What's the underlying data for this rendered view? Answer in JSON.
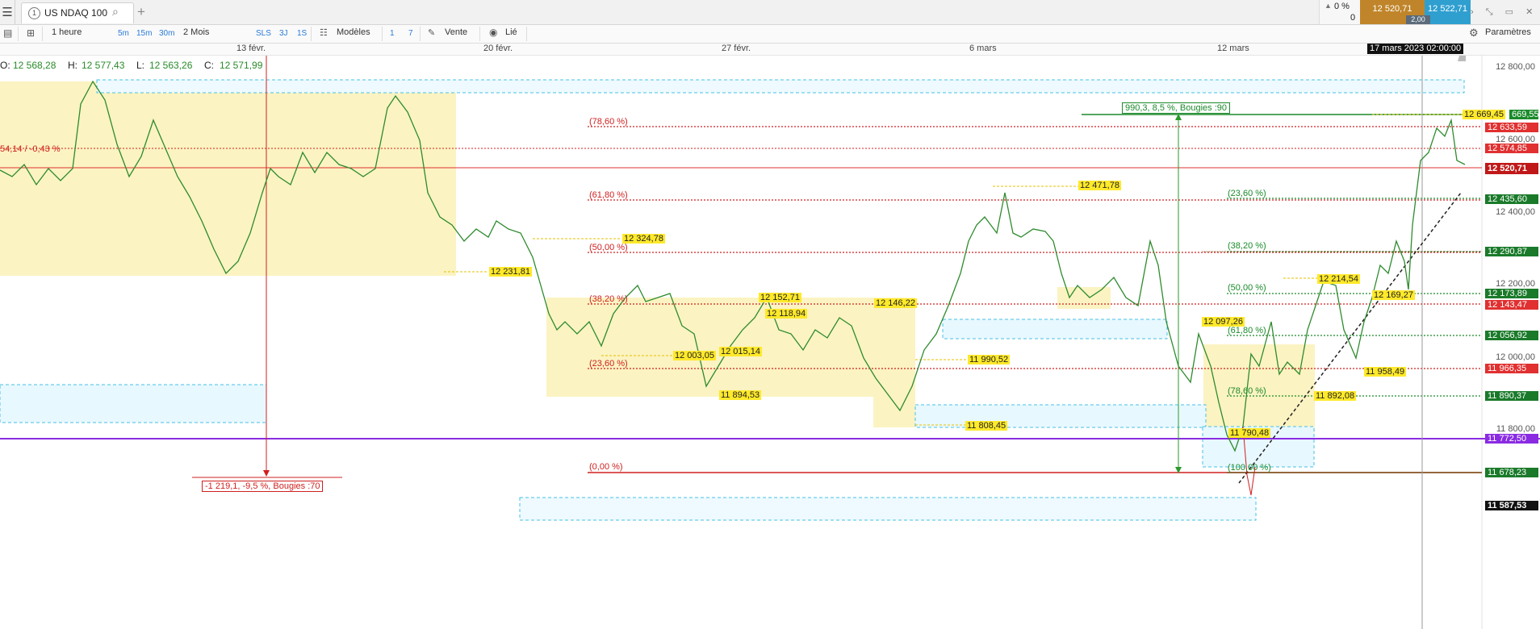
{
  "tab": {
    "number": "1",
    "title": "US NDAQ 100"
  },
  "toolbar": {
    "interval": "1 heure",
    "intervals": [
      "5m",
      "15m",
      "30m"
    ],
    "period": "2 Mois",
    "modes": [
      "SLS",
      "3J",
      "1S"
    ],
    "models": "Modèles",
    "days": [
      "1",
      "7"
    ],
    "sell": "Vente",
    "linked": "Lié",
    "settings": "Paramètres"
  },
  "position": {
    "pct": "0 %",
    "qty": "0",
    "bid": "12 520,71",
    "ask": "12 522,71",
    "spread": "2,00"
  },
  "dates": [
    "13 févr.",
    "20 févr.",
    "27 févr.",
    "6 mars",
    "12 mars"
  ],
  "cursor_date": "17 mars 2023 02:00:00",
  "ohlc": {
    "o_label": "O:",
    "o": "12 568,28",
    "h_label": "H:",
    "h": "12 577,43",
    "l_label": "L:",
    "l": "12 563,26",
    "c_label": "C:",
    "c": "12 571,99"
  },
  "y_axis": [
    "12 800,00",
    "12 600,00",
    "12 400,00",
    "12 200,00",
    "12 000,00",
    "11 800,00"
  ],
  "price_tags": {
    "t1": "669,55",
    "t2": "12 633,59",
    "t3": "12 574,85",
    "t4": "12 520,71",
    "t5": "12 435,60",
    "t6": "12 290,87",
    "t7": "12 173,89",
    "t8": "12 143,47",
    "t9": "12 056,92",
    "t10": "11 966,35",
    "t11": "11 890,37",
    "t12": "11 772,50",
    "t13": "11 678,23",
    "t14": "11 587,53"
  },
  "fib_left": [
    "(78,60 %)",
    "(61,80 %)",
    "(50,00 %)",
    "(38,20 %)",
    "(23,60 %)",
    "(0,00 %)"
  ],
  "fib_right": [
    "(23,60 %)",
    "(38,20 %)",
    "(50,00 %)",
    "(61,80 %)",
    "(78,60 %)",
    "(100,00 %)"
  ],
  "labels": {
    "l1": "12 471,78",
    "l2": "12 324,78",
    "l3": "12 231,81",
    "l4": "12 152,71",
    "l5": "12 146,22",
    "l6": "12 118,94",
    "l7": "12 015,14",
    "l8": "12 003,05",
    "l9": "11 990,52",
    "l10": "11 894,53",
    "l11": "11 808,45",
    "l12": "12 097,26",
    "l13": "12 214,54",
    "l14": "12 169,27",
    "l15": "11 958,49",
    "l16": "11 892,08",
    "l17": "11 790,48",
    "l18": "12 669,45"
  },
  "measure_up": "990,3, 8,5 %, Bougies :90",
  "measure_down": "-1 219,1, -9,5 %, Bougies :70",
  "left_pct": "54,14 / -0,43 %"
}
